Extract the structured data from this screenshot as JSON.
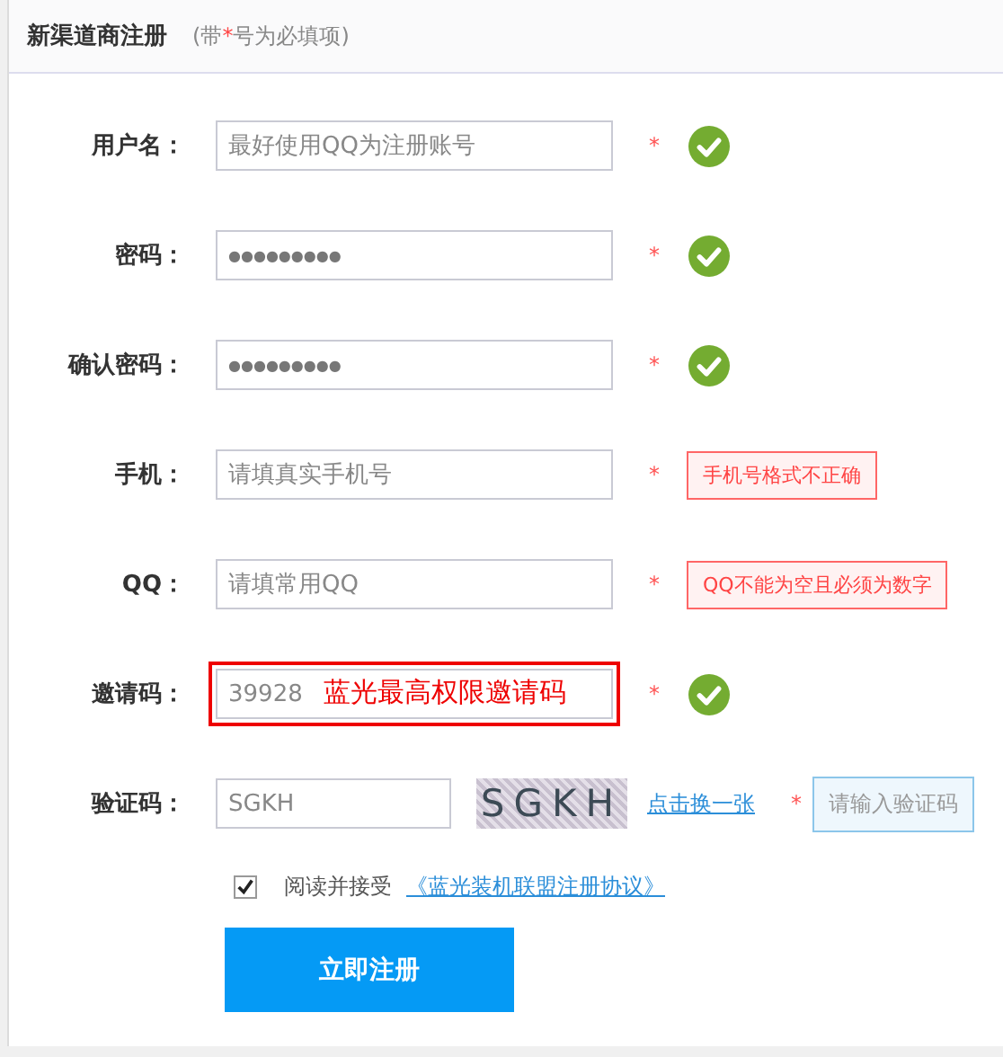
{
  "header": {
    "title": "新渠道商注册",
    "note_before": "(带",
    "note_star": "*",
    "note_after": "号为必填项)"
  },
  "fields": [
    {
      "label": "用户名：",
      "kind": "text",
      "placeholder": "最好使用QQ为注册账号",
      "required": "*",
      "valid": true
    },
    {
      "label": "密码：",
      "kind": "password",
      "value": "●●●●●●●●●",
      "required": "*",
      "valid": true
    },
    {
      "label": "确认密码：",
      "kind": "password",
      "value": "●●●●●●●●●",
      "required": "*",
      "valid": true
    },
    {
      "label": "手机：",
      "kind": "text",
      "placeholder": "请填真实手机号",
      "required": "*",
      "valid": false,
      "message": "手机号格式不正确"
    },
    {
      "label": "QQ：",
      "kind": "text",
      "placeholder": "请填常用QQ",
      "required": "*",
      "valid": false,
      "message": "QQ不能为空且必须为数字"
    },
    {
      "label": "邀请码：",
      "kind": "text",
      "value": "39928",
      "required": "*",
      "valid": true,
      "annotation": "蓝光最高权限邀请码"
    }
  ],
  "captcha": {
    "label": "验证码：",
    "value": "SGKH",
    "image_text": "SGKH",
    "refresh_link": "点击换一张",
    "required": "*",
    "hint": "请输入验证码"
  },
  "agreement": {
    "checked": true,
    "text": "阅读并接受",
    "link": "《蓝光装机联盟注册协议》"
  },
  "submit": "立即注册"
}
